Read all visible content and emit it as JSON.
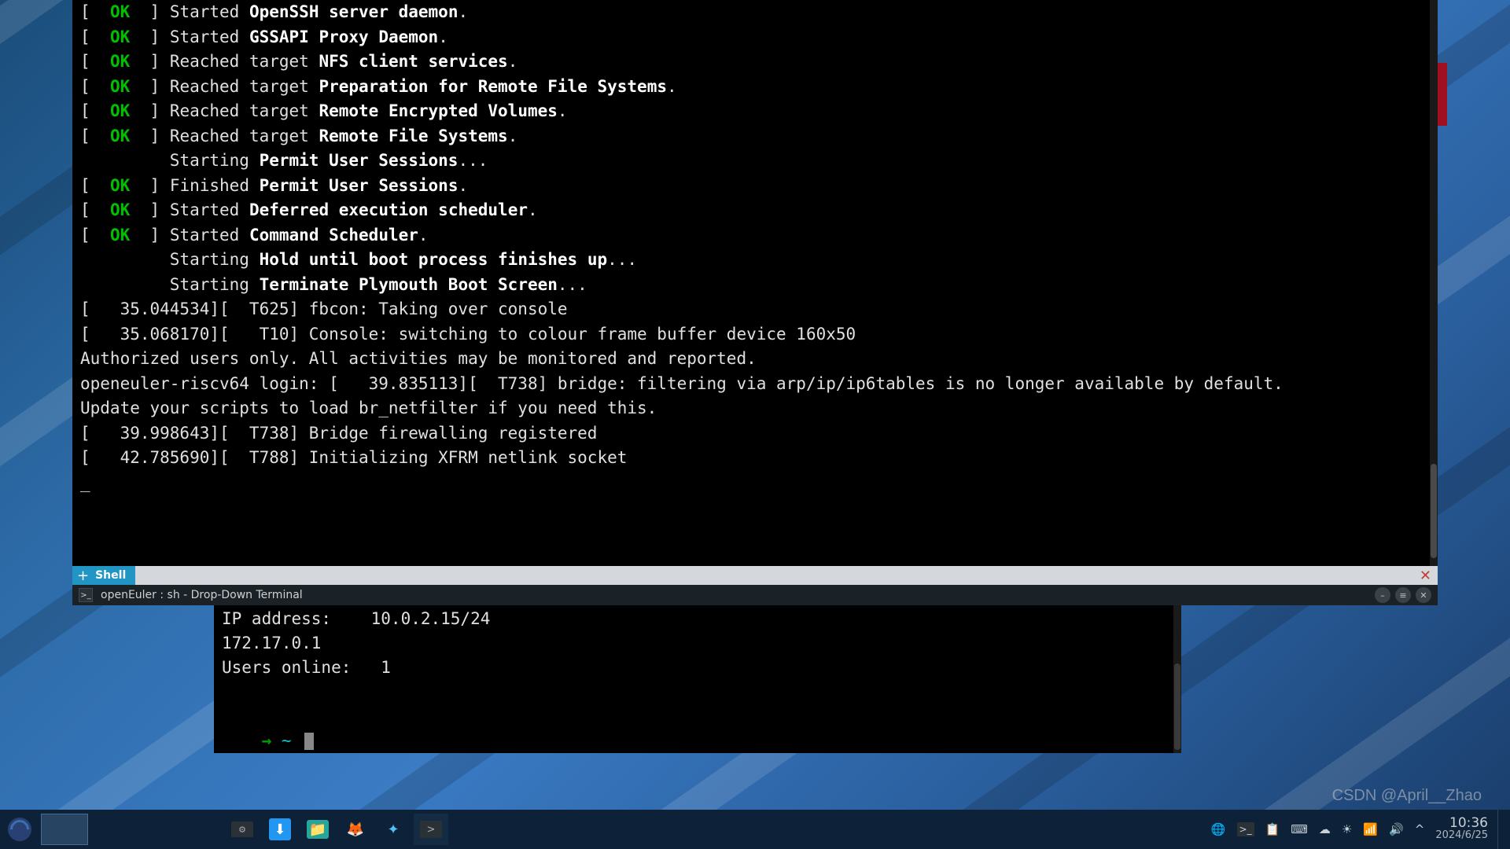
{
  "boot": {
    "lines": [
      {
        "status": "OK",
        "prefix": "Started ",
        "bold": "OpenSSH server daemon",
        "suffix": "."
      },
      {
        "status": "OK",
        "prefix": "Started ",
        "bold": "GSSAPI Proxy Daemon",
        "suffix": "."
      },
      {
        "status": "OK",
        "prefix": "Reached target ",
        "bold": "NFS client services",
        "suffix": "."
      },
      {
        "status": "OK",
        "prefix": "Reached target ",
        "bold": "Preparation for Remote File Systems",
        "suffix": "."
      },
      {
        "status": "OK",
        "prefix": "Reached target ",
        "bold": "Remote Encrypted Volumes",
        "suffix": "."
      },
      {
        "status": "OK",
        "prefix": "Reached target ",
        "bold": "Remote File Systems",
        "suffix": "."
      },
      {
        "status": "",
        "prefix": "Starting ",
        "bold": "Permit User Sessions",
        "suffix": "..."
      },
      {
        "status": "OK",
        "prefix": "Finished ",
        "bold": "Permit User Sessions",
        "suffix": "."
      },
      {
        "status": "OK",
        "prefix": "Started ",
        "bold": "Deferred execution scheduler",
        "suffix": "."
      },
      {
        "status": "OK",
        "prefix": "Started ",
        "bold": "Command Scheduler",
        "suffix": "."
      },
      {
        "status": "",
        "prefix": "Starting ",
        "bold": "Hold until boot process finishes up",
        "suffix": "..."
      },
      {
        "status": "",
        "prefix": "Starting ",
        "bold": "Terminate Plymouth Boot Screen",
        "suffix": "..."
      }
    ],
    "kernel1": "[   35.044534][  T625] fbcon: Taking over console",
    "kernel2": "[   35.068170][   T10] Console: switching to colour frame buffer device 160x50",
    "blank": "",
    "auth": "Authorized users only. All activities may be monitored and reported.",
    "login": "openeuler-riscv64 login: [   39.835113][  T738] bridge: filtering via arp/ip/ip6tables is no longer available by default.",
    "login2": "Update your scripts to load br_netfilter if you need this.",
    "kernel3": "[   39.998643][  T738] Bridge firewalling registered",
    "kernel4": "[   42.785690][  T788] Initializing XFRM netlink socket",
    "cursor": "_"
  },
  "shellTab": {
    "plus": "+",
    "label": "Shell"
  },
  "ddTitle": "openEuler : sh - Drop-Down Terminal",
  "lower": {
    "l1": "IP address:    10.0.2.15/24",
    "l2": "172.17.0.1",
    "l3": "Users online:   1",
    "promptArrow": "→ ",
    "promptTilde": "~ "
  },
  "watermark": "CSDN @April__Zhao",
  "clock": {
    "time": "10:36",
    "date": "2024/6/25"
  },
  "tray": {
    "globe": "🌐",
    "term": ">_",
    "clip": "📋",
    "kbd": "⌨",
    "cloud": "☁",
    "sun": "☀",
    "wifi": "📶",
    "vol": "🔊",
    "caret": "^"
  }
}
